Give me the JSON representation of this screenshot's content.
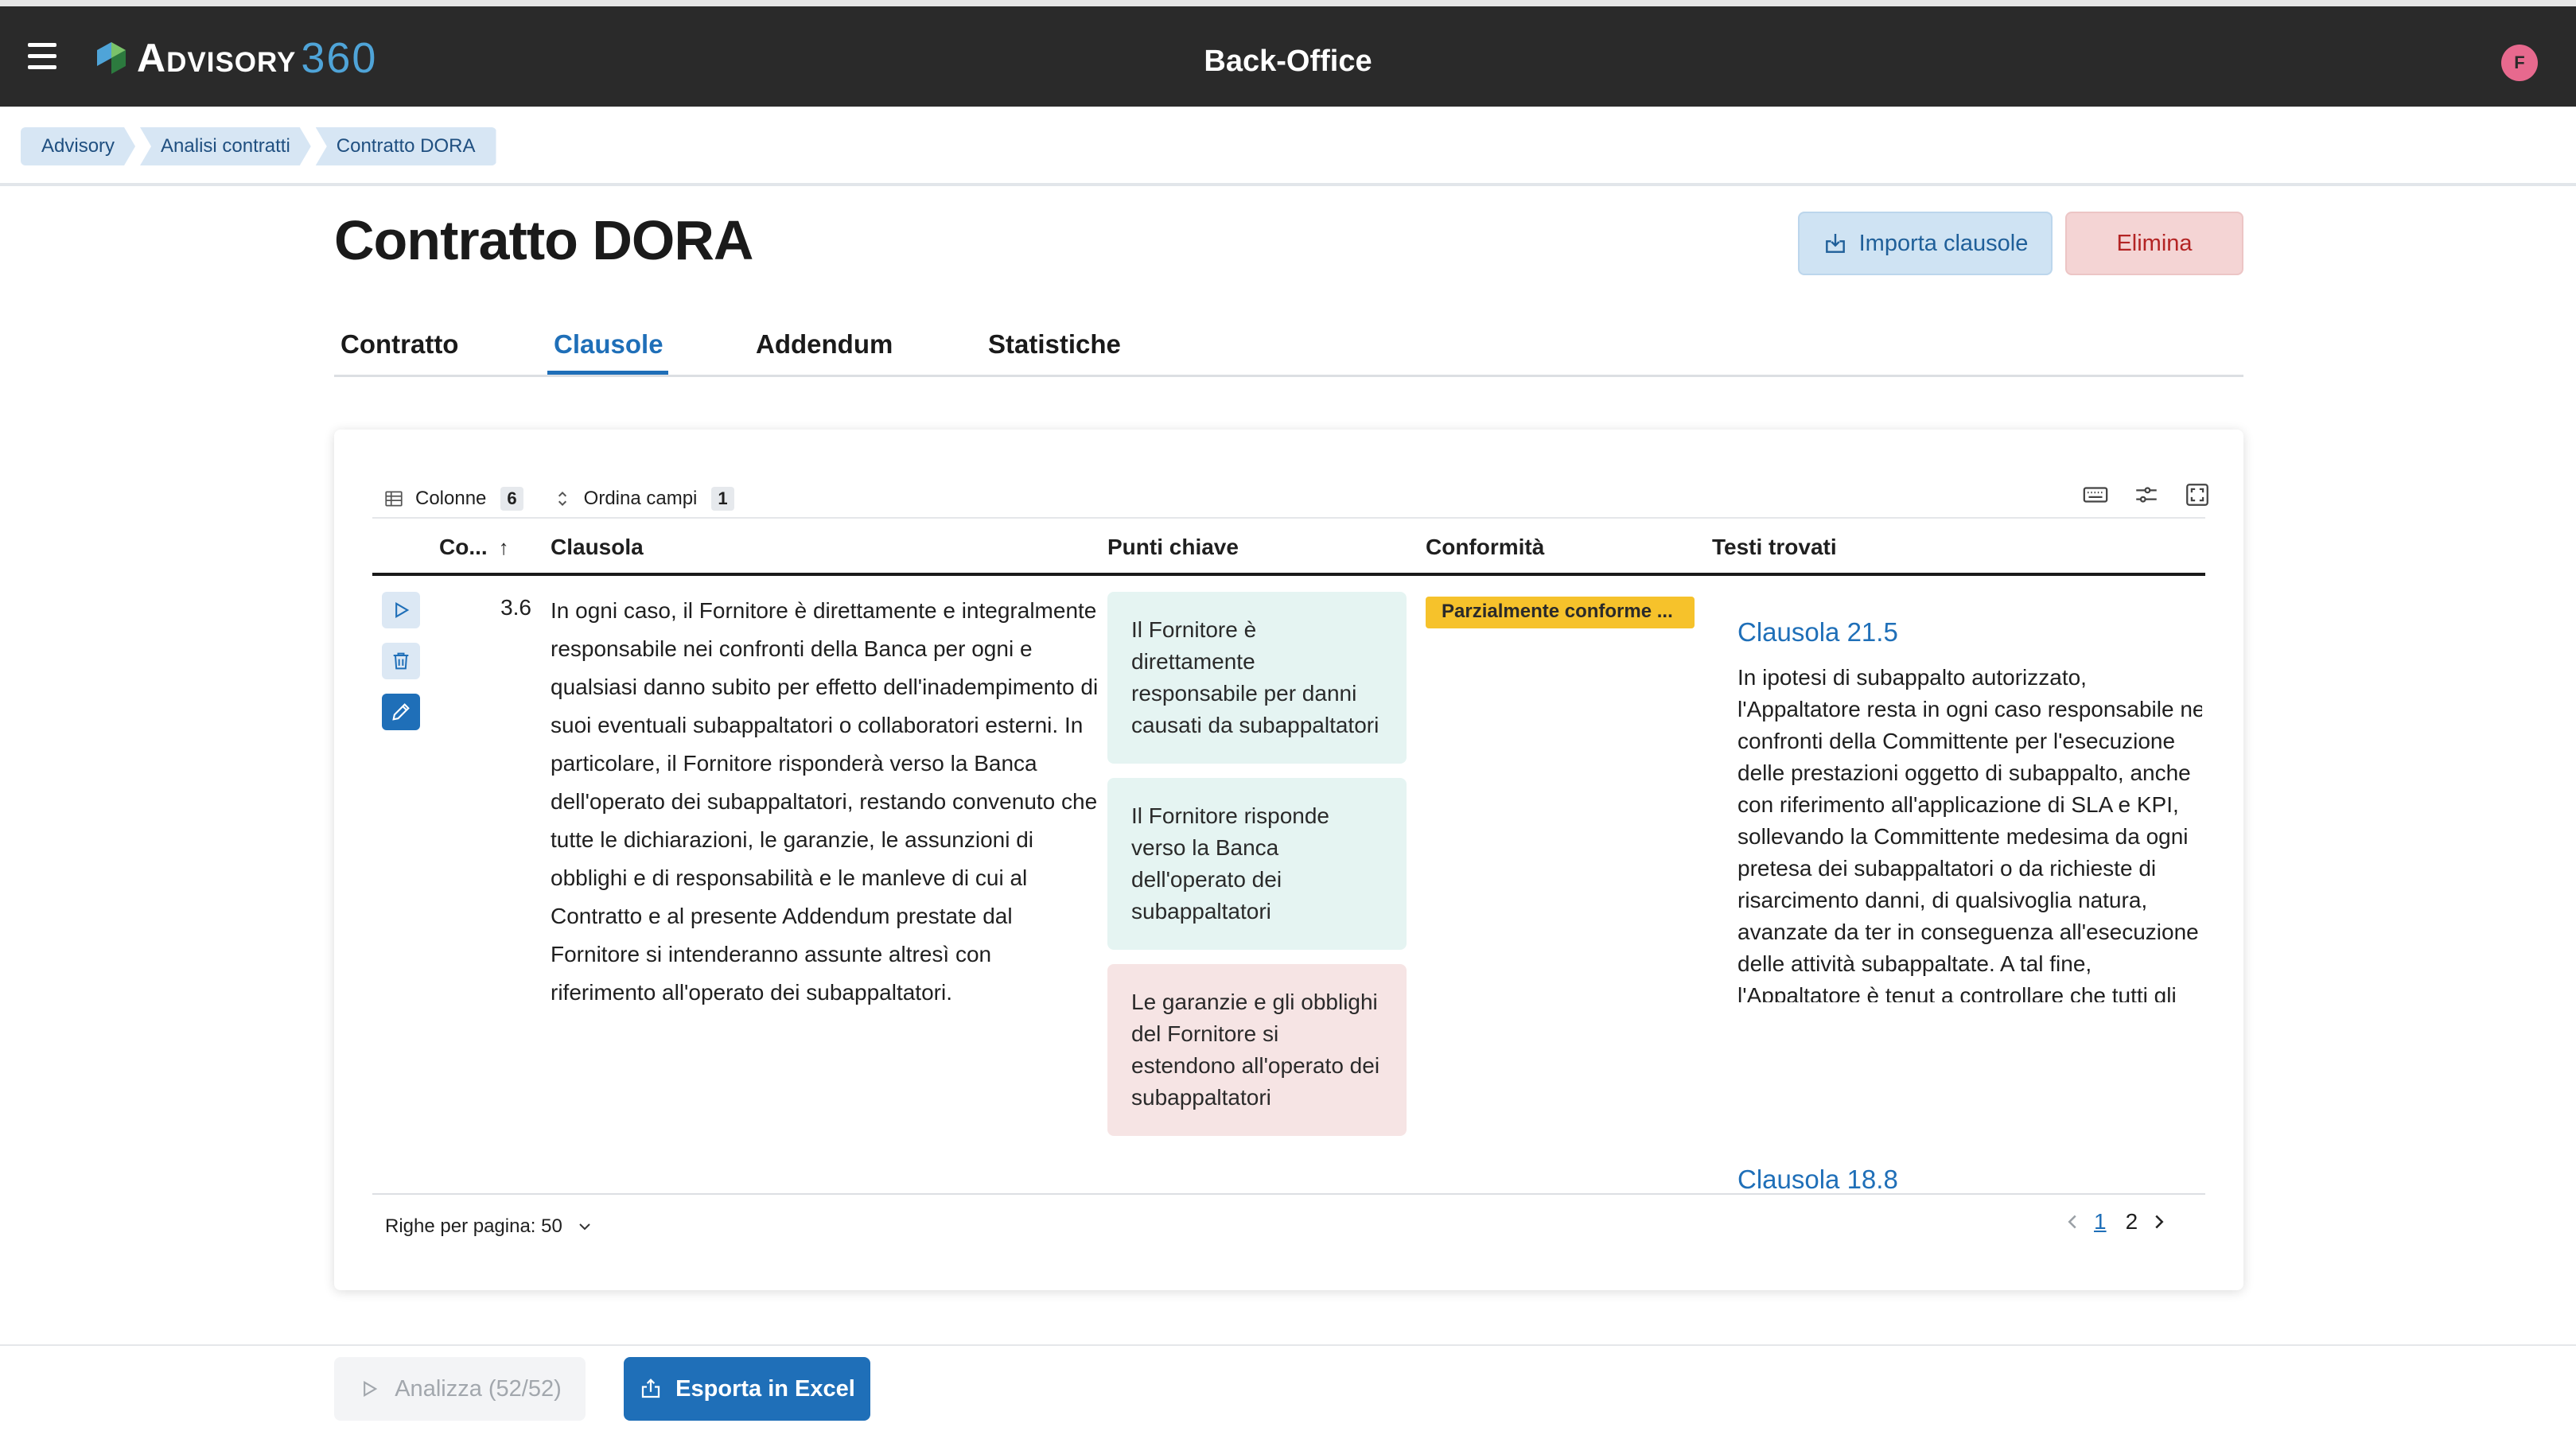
{
  "header": {
    "logo_text": "Advisory",
    "logo_number": "360",
    "app_title": "Back-Office",
    "avatar_initial": "F"
  },
  "breadcrumb": [
    "Advisory",
    "Analisi contratti",
    "Contratto DORA"
  ],
  "page": {
    "title": "Contratto DORA",
    "import_label": "Importa clausole",
    "delete_label": "Elimina"
  },
  "tabs": [
    "Contratto",
    "Clausole",
    "Addendum",
    "Statistiche"
  ],
  "active_tab": "Clausole",
  "toolbar": {
    "columns_label": "Colonne",
    "columns_count": "6",
    "sort_label": "Ordina campi",
    "sort_count": "1"
  },
  "table": {
    "headers": [
      "Co...",
      "Clausola",
      "Punti chiave",
      "Conformità",
      "Testi trovati"
    ],
    "row": {
      "code": "3.6",
      "clause": "In ogni caso, il Fornitore è direttamente e integralmente responsabile nei confronti della Banca per ogni e qualsiasi danno subito per effetto dell'inadempimento di suoi eventuali subappaltatori o collaboratori esterni. In particolare, il Fornitore risponderà verso la Banca dell'operato dei subappaltatori, restando convenuto che tutte le dichiarazioni, le garanzie, le assunzioni di obblighi e di responsabilità e le manleve di cui al Contratto e al presente Addendum prestate dal Fornitore si intenderanno assunte altresì con riferimento all'operato dei subappaltatori.",
      "key_points": [
        "Il Fornitore è direttamente responsabile per danni causati da subappaltatori",
        "Il Fornitore risponde verso la Banca dell'operato dei subappaltatori",
        "Le garanzie e gli obblighi del Fornitore si estendono all'operato dei subappaltatori"
      ],
      "conformity": "Parzialmente conforme ...",
      "found_texts": [
        {
          "title": "Clausola 21.5",
          "text": "In ipotesi di subappalto autorizzato, l'Appaltatore resta in ogni caso responsabile nei confronti della Committente per l'esecuzione delle prestazioni oggetto di subappalto, anche con riferimento all'applicazione di SLA e KPI, sollevando la Committente medesima da ogni pretesa dei subappaltatori o da richieste di risarcimento danni, di qualsivoglia natura, avanzate da ter in conseguenza all'esecuzione delle attività subappaltate. A tal fine, l'Appaltatore è tenut a controllare che tutti gli obblighi contrattuali relativi ai servizi subappaltati siano rispettati nel continuo."
        },
        {
          "title": "Clausola 18.8"
        }
      ]
    }
  },
  "footer": {
    "rows_per_page": "Righe per pagina: 50",
    "pages": [
      "1",
      "2"
    ],
    "current_page": "1"
  },
  "bottom": {
    "analyze_label": "Analizza (52/52)",
    "export_label": "Esporta in Excel"
  },
  "colors": {
    "accent": "#1f6fb8",
    "header_bg": "#2a2a2a",
    "badge_partial": "#f6c22b",
    "kp_green": "#e5f4f2",
    "kp_red": "#f6e4e4"
  }
}
